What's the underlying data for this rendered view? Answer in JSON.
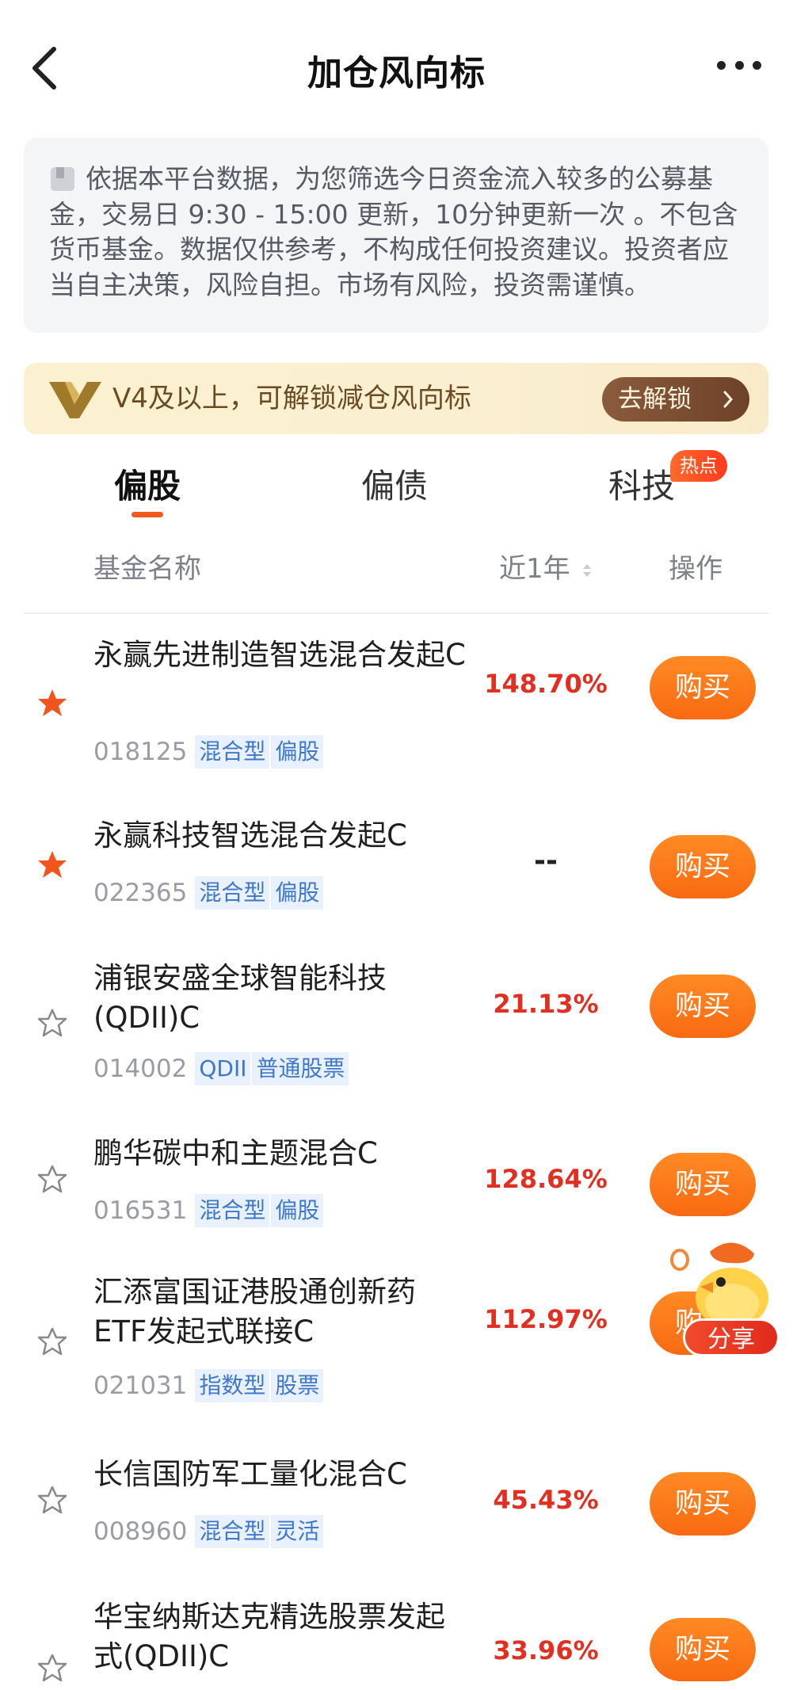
{
  "header": {
    "title": "加仓风向标",
    "back_icon": "chevron-left-icon",
    "more_icon": "more-dots-icon"
  },
  "notice": {
    "icon": "document-icon",
    "text": "依据本平台数据，为您筛选今日资金流入较多的公募基金，交易日 9:30 - 15:00 更新，10分钟更新一次 。不包含货币基金。数据仅供参考，不构成任何投资建议。投资者应当自主决策，风险自担。市场有风险，投资需谨慎。"
  },
  "vip": {
    "logo_icon": "v-crown-logo",
    "text": "V4及以上，可解锁减仓风向标",
    "button_label": "去解锁"
  },
  "tabs": [
    {
      "label": "偏股",
      "active": true
    },
    {
      "label": "偏债",
      "active": false
    },
    {
      "label": "科技",
      "active": false,
      "badge": "热点"
    }
  ],
  "table_header": {
    "name": "基金名称",
    "year": "近1年",
    "operation": "操作"
  },
  "funds": [
    {
      "name": "永赢先进制造智选混合发起C",
      "code": "018125",
      "tags": [
        "混合型",
        "偏股"
      ],
      "rate": "148.70%",
      "starred": true,
      "buy": "购买"
    },
    {
      "name": "永赢科技智选混合发起C",
      "code": "022365",
      "tags": [
        "混合型",
        "偏股"
      ],
      "rate": "--",
      "starred": true,
      "buy": "购买"
    },
    {
      "name": "浦银安盛全球智能科技(QDII)C",
      "code": "014002",
      "tags": [
        "QDII",
        "普通股票"
      ],
      "rate": "21.13%",
      "starred": false,
      "buy": "购买"
    },
    {
      "name": "鹏华碳中和主题混合C",
      "code": "016531",
      "tags": [
        "混合型",
        "偏股"
      ],
      "rate": "128.64%",
      "starred": false,
      "buy": "购买"
    },
    {
      "name": "汇添富国证港股通创新药ETF发起式联接C",
      "code": "021031",
      "tags": [
        "指数型",
        "股票"
      ],
      "rate": "112.97%",
      "starred": false,
      "buy": "购买"
    },
    {
      "name": "长信国防军工量化混合C",
      "code": "008960",
      "tags": [
        "混合型",
        "灵活"
      ],
      "rate": "45.43%",
      "starred": false,
      "buy": "购买"
    },
    {
      "name": "华宝纳斯达克精选股票发起式(QDII)C",
      "code": "",
      "tags": [],
      "rate": "33.96%",
      "starred": false,
      "buy": "购买"
    }
  ],
  "share": {
    "label": "分享",
    "icon": "chick-mascot-icon"
  },
  "colors": {
    "accent": "#f96a12",
    "rate_red": "#e12f22",
    "tag_blue": "#3e78c8",
    "tag_bg": "#e8f1fd"
  }
}
